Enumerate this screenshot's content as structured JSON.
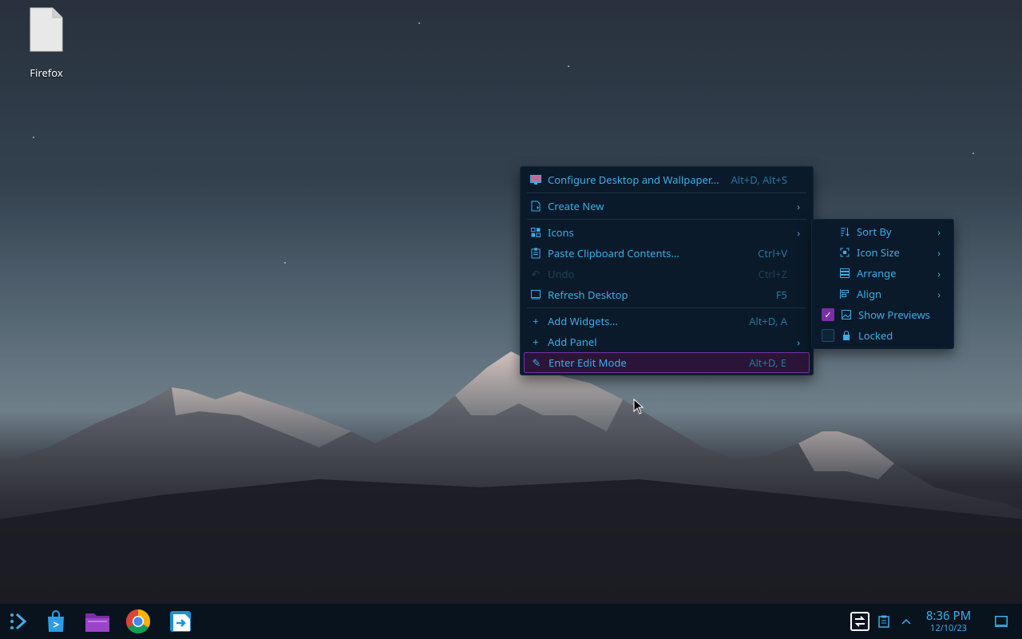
{
  "desktop": {
    "icons": [
      {
        "label": "Firefox",
        "icon": "file-icon"
      }
    ]
  },
  "context_menu": {
    "items": [
      {
        "label": "Configure Desktop and Wallpaper...",
        "shortcut": "Alt+D, Alt+S",
        "icon": "configure-desktop-icon"
      },
      {
        "label": "Create New",
        "submenu": true,
        "icon": "new-document-icon"
      },
      {
        "label": "Icons",
        "submenu": true,
        "icon": "icons-grid-icon"
      },
      {
        "label": "Paste Clipboard Contents...",
        "shortcut": "Ctrl+V",
        "icon": "clipboard-icon"
      },
      {
        "label": "Undo",
        "shortcut": "Ctrl+Z",
        "disabled": true,
        "icon": "undo-icon"
      },
      {
        "label": "Refresh Desktop",
        "shortcut": "F5",
        "icon": "refresh-desktop-icon"
      },
      {
        "label": "Add Widgets...",
        "shortcut": "Alt+D, A",
        "icon": "plus-icon"
      },
      {
        "label": "Add Panel",
        "submenu": true,
        "icon": "plus-icon"
      },
      {
        "label": "Enter Edit Mode",
        "shortcut": "Alt+D, E",
        "highlighted": true,
        "icon": "pencil-icon"
      }
    ]
  },
  "icons_submenu": {
    "items": [
      {
        "label": "Sort By",
        "submenu": true,
        "icon": "sort-icon"
      },
      {
        "label": "Icon Size",
        "submenu": true,
        "icon": "icon-size-icon"
      },
      {
        "label": "Arrange",
        "submenu": true,
        "icon": "arrange-icon"
      },
      {
        "label": "Align",
        "submenu": true,
        "icon": "align-icon"
      },
      {
        "label": "Show Previews",
        "checked": true,
        "icon": "image-icon"
      },
      {
        "label": "Locked",
        "checked": false,
        "icon": "lock-icon"
      }
    ]
  },
  "taskbar": {
    "apps": [
      "app-launcher-icon",
      "discover-store-icon",
      "file-manager-icon",
      "chrome-icon",
      "remote-desktop-icon"
    ],
    "clock": {
      "time": "8:36 PM",
      "date": "12/10/23"
    }
  },
  "colors": {
    "accent": "#3daee9",
    "highlight": "#7a2fa8",
    "menu_bg": "#0b1a2a",
    "taskbar_bg": "#08131e"
  }
}
